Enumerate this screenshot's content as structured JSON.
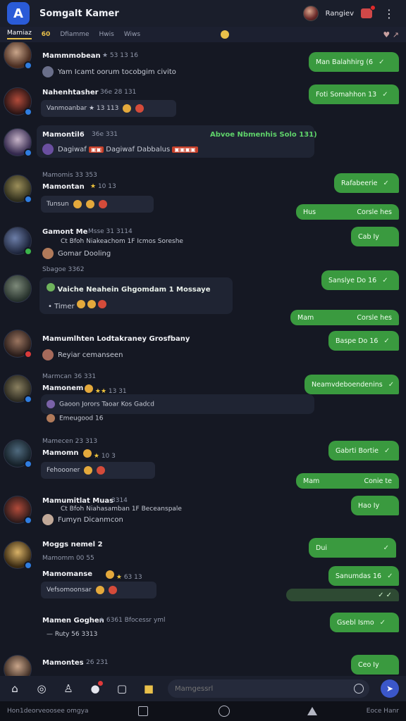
{
  "app": {
    "title": "Somgalt Kamer",
    "user_label": "Rangiev"
  },
  "tabs": [
    {
      "label": "Mamiaz"
    },
    {
      "label": "60"
    },
    {
      "label": "Dfiamme"
    },
    {
      "label": "Hwis"
    },
    {
      "label": "Wiws"
    }
  ],
  "tab_right": "♥ ↗",
  "messages": [
    {
      "name": "Mammmobean",
      "meta": "★ 53 13 16",
      "sub": "Yam Icamt oorum tocobgim civito",
      "out": "Man Balahhirg (6"
    },
    {
      "name": "Nahenhtasher",
      "meta": "36e 28 131",
      "reply": "Vanmoanbar ★ 13 113",
      "out": "Foti Somahhon 13"
    },
    {
      "name": "Mamontil6",
      "meta": "36e 331",
      "green": "Abvoe Nbmenhis Solo 131)",
      "reply_badges": "Dagiwaf Dabbalus",
      "out": "Dagiwaf"
    },
    {
      "name": "Mamontan",
      "meta": "Mamomis 33 353",
      "reply": "Tunsun",
      "out": "Rafabeerie"
    },
    {
      "name": "",
      "meta": "",
      "out2": "Hus",
      "out2b": "Corsle hes"
    },
    {
      "name": "Gamont Me",
      "meta": "Msse 31 3114",
      "sub": "Ct Bfoh Niakeachom 1F Icmos Soreshe",
      "sub2": "Gomar Dooling",
      "out": "Cab Iy"
    },
    {
      "name": "",
      "meta": "Sbagoe 3362",
      "green_panel": "Vaiche Neahein Ghgomdam 1 Mossaye",
      "reply": "Timer",
      "out": "Sanslye Do 16"
    },
    {
      "name": "",
      "meta": "",
      "out2": "Mam",
      "out2b": "Corsle hes"
    },
    {
      "name": "Mamumlhten Lodtakraney Grosfbany",
      "sub": "Reyiar cemanseen",
      "out": "Baspe Do 16"
    },
    {
      "name": "Mamonem",
      "meta": "Marmcan 36 331",
      "reply": "Gaoon Jorors Taoar Kos Gadcd",
      "reply2": "Emeugood 16",
      "out": "Neamvdeboendenins"
    },
    {
      "name": "Mamomn",
      "meta": "Mamecen 23 313",
      "reply": "Fehoooner",
      "out": "Gabrti Bortie"
    },
    {
      "name": "",
      "meta": "",
      "out2": "Mam",
      "out2b": "Conie te"
    },
    {
      "name": "Mamumitlat Muas",
      "meta": "3314",
      "sub": "Ct Bfoh Niahasamban 1F Beceanspale",
      "sub2": "Fumyn Dicanmcon",
      "out": "Hao Iy"
    },
    {
      "name": "Moggs nemel 2",
      "meta": "Mamomm 00 55",
      "out": "Dui"
    },
    {
      "name": "",
      "meta": "Mamomanse",
      "reply": "Vefsomoonsar",
      "out": "Sanumdas 16"
    },
    {
      "name": "Mamen Goghen",
      "meta": "★ 6361 Bfocessr yml",
      "reply": "Ruty 56 3313",
      "out": "Gsebl Ismo"
    },
    {
      "name": "Mamontes",
      "meta": "26 231",
      "out": "Ceo Iy"
    }
  ],
  "composer": {
    "placeholder": "Mamgessrl"
  },
  "system": {
    "left": "Hon1deorveoosee omgya",
    "right": "Eoce Hanr"
  }
}
